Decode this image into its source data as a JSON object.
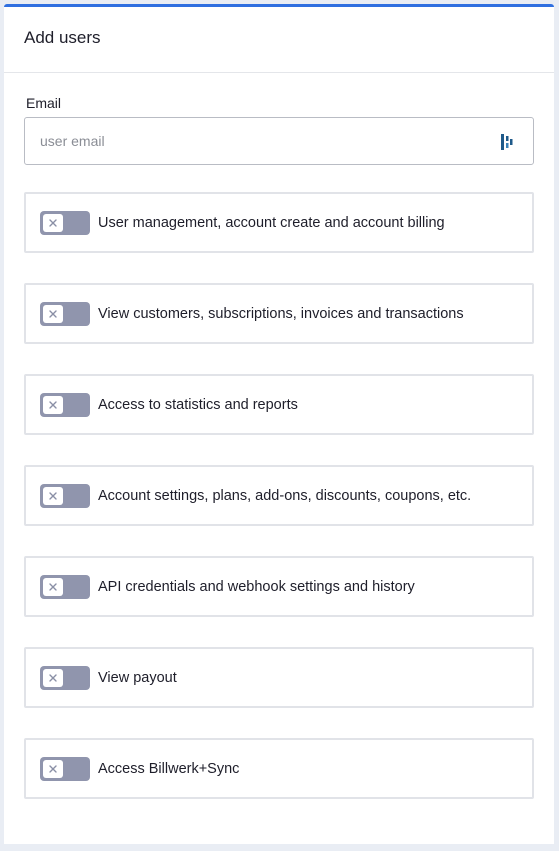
{
  "panel": {
    "title": "Add users"
  },
  "email": {
    "label": "Email",
    "placeholder": "user email",
    "value": ""
  },
  "permissions": [
    {
      "label": "User management, account create and account billing",
      "enabled": false
    },
    {
      "label": "View customers, subscriptions, invoices and transactions",
      "enabled": false
    },
    {
      "label": "Access to statistics and reports",
      "enabled": false
    },
    {
      "label": "Account settings, plans, add-ons, discounts, coupons, etc.",
      "enabled": false
    },
    {
      "label": "API credentials and webhook settings and history",
      "enabled": false
    },
    {
      "label": "View payout",
      "enabled": false
    },
    {
      "label": "Access Billwerk+Sync",
      "enabled": false
    }
  ],
  "icons": {
    "toggle_off": "x-icon",
    "autofill": "password-manager-icon"
  },
  "colors": {
    "accent": "#2f6fe0",
    "toggle_off": "#9095ad",
    "autofill_icon": "#1f5a8a"
  }
}
